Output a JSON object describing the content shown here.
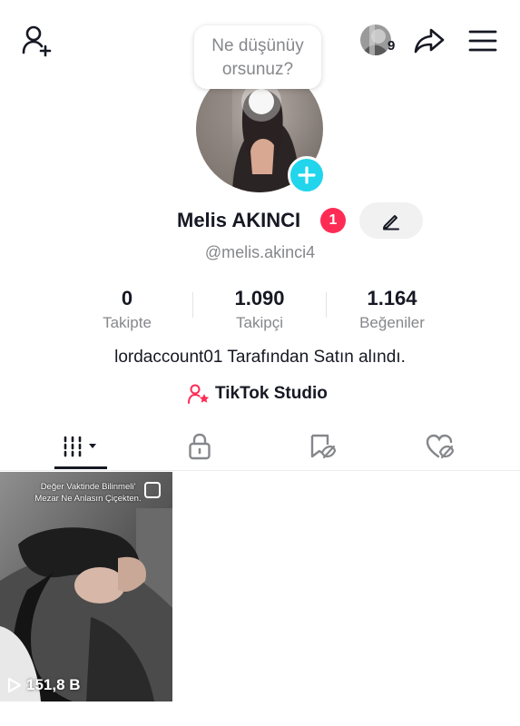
{
  "header": {
    "add_friend_icon": "person-plus-icon",
    "friends_count": "9",
    "share_icon": "share-arrow-icon",
    "menu_icon": "hamburger-menu-icon"
  },
  "note_bubble": {
    "text_line1": "Ne düşünüy",
    "text_line2": "orsunuz?"
  },
  "profile": {
    "name": "Melis AKINCI",
    "notification_count": "1",
    "username": "@melis.akinci4",
    "bio": "lordaccount01 Tarafından Satın alındı.",
    "studio_label": "TikTok Studio"
  },
  "stats": [
    {
      "value": "0",
      "label": "Takipte"
    },
    {
      "value": "1.090",
      "label": "Takipçi"
    },
    {
      "value": "1.164",
      "label": "Beğeniler"
    }
  ],
  "tabs": [
    {
      "icon": "grid-icon",
      "active": true
    },
    {
      "icon": "lock-icon",
      "active": false
    },
    {
      "icon": "tagged-icon",
      "active": false
    },
    {
      "icon": "liked-heart-icon",
      "active": false
    }
  ],
  "videos": [
    {
      "caption_line1": "Değer Vaktinde Bilinmeli'",
      "caption_line2": "Mezar Ne Anlasın Çiçekten.",
      "views": "151,8 B"
    }
  ],
  "colors": {
    "accent_cyan": "#20d5ec",
    "accent_red": "#fe2c55",
    "text_primary": "#161823",
    "text_secondary": "#86878b"
  }
}
